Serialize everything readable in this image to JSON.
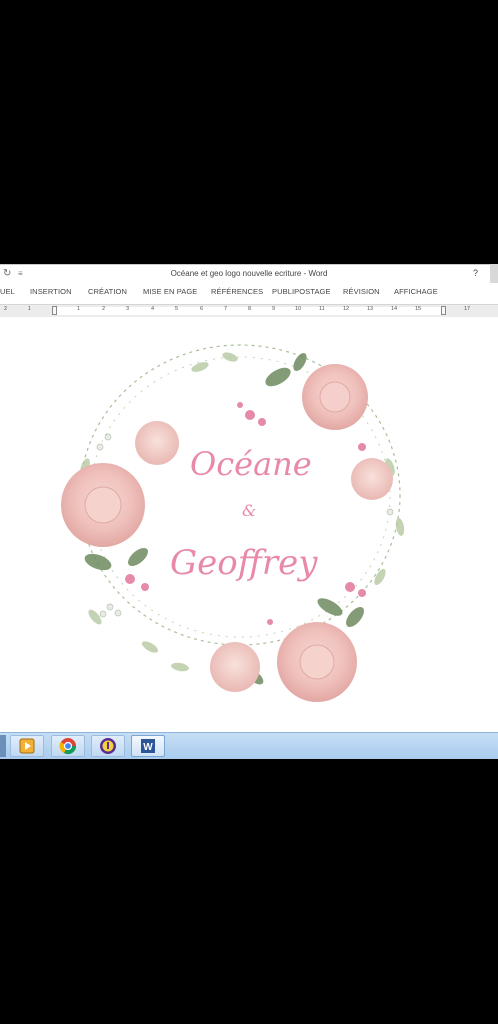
{
  "window": {
    "title": "Océane et geo logo nouvelle ecriture - Word",
    "help": "?",
    "undo_icon": "undo-icon",
    "qat_icon": "customize-quick-access-icon"
  },
  "ribbon": {
    "tabs": [
      "UEL",
      "INSERTION",
      "CRÉATION",
      "MISE EN PAGE",
      "RÉFÉRENCES",
      "PUBLIPOSTAGE",
      "RÉVISION",
      "AFFICHAGE"
    ]
  },
  "ruler": {
    "numbers": [
      "2",
      "1",
      "1",
      "2",
      "3",
      "4",
      "5",
      "6",
      "7",
      "8",
      "9",
      "10",
      "11",
      "12",
      "13",
      "14",
      "15",
      "17"
    ]
  },
  "document": {
    "name1": "Océane",
    "ampersand": "&",
    "name2": "Geoffrey",
    "colors": {
      "text_pink": "#e889a8",
      "rose": "#f3c8c4",
      "leaf": "#6e8a5f"
    }
  },
  "taskbar": {
    "items": [
      {
        "name": "media-player-icon"
      },
      {
        "name": "chrome-icon"
      },
      {
        "name": "vpn-icon"
      },
      {
        "name": "word-icon"
      }
    ]
  }
}
